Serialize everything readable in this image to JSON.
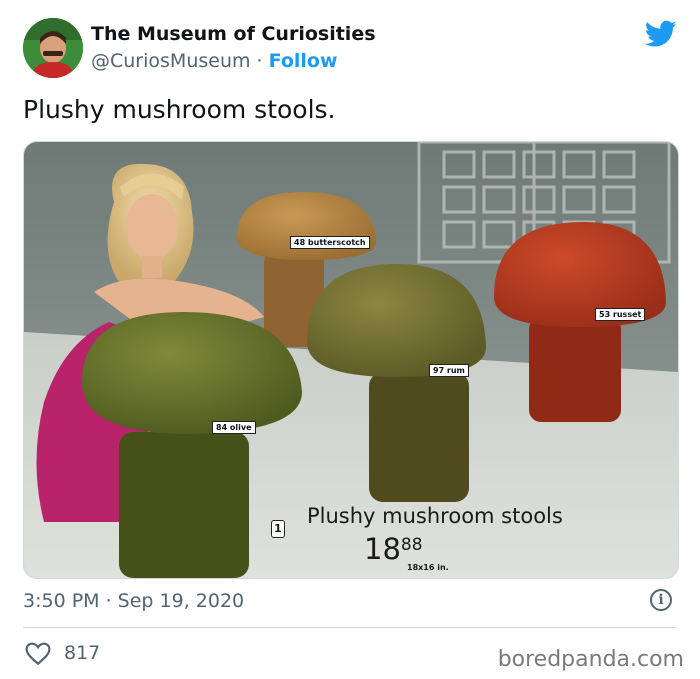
{
  "tweet": {
    "display_name": "The Museum of Curiosities",
    "handle": "@CuriosMuseum",
    "separator": "·",
    "follow_label": "Follow",
    "text": "Plushy mushroom stools.",
    "timestamp": "3:50 PM · Sep 19, 2020",
    "likes": "817",
    "info_glyph": "i"
  },
  "image": {
    "tags": {
      "butterscotch": "48 butterscotch",
      "russet": "53 russet",
      "rum": "97 rum",
      "olive": "84 olive"
    },
    "caption_number": "1",
    "caption": "Plushy mushroom stools",
    "price_dollars": "18",
    "price_cents": "88",
    "size": "18x16 in."
  },
  "watermark": "boredpanda.com",
  "colors": {
    "twitter_blue": "#1d9bf0",
    "text_primary": "#0f1419",
    "text_secondary": "#536471"
  },
  "icons": {
    "logo": "twitter-bird-icon",
    "info": "info-icon",
    "like": "heart-icon"
  }
}
